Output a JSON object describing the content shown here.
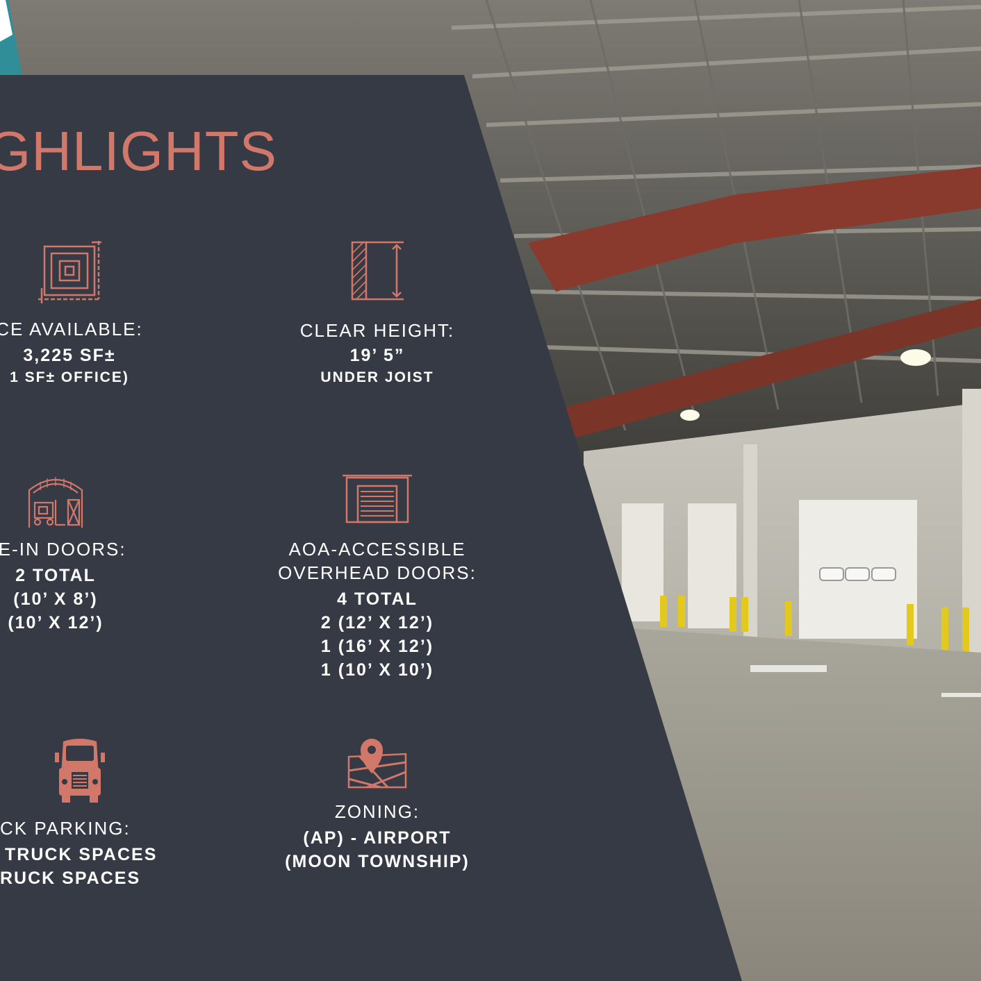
{
  "heading": "GHLIGHTS",
  "colors": {
    "panel": "#363a45",
    "accent": "#d2786a",
    "teal": "#2f8e98",
    "text": "#ffffff"
  },
  "items": {
    "space": {
      "icon": "floor-plan-icon",
      "label": "CE AVAILABLE:",
      "value": "3,225 SF±",
      "sub": "1 SF± OFFICE)"
    },
    "height": {
      "icon": "clear-height-icon",
      "label": "CLEAR HEIGHT:",
      "value": "19’ 5”",
      "sub": "UNDER JOIST"
    },
    "drive": {
      "icon": "warehouse-forklift-icon",
      "label": "VE-IN DOORS:",
      "lines": [
        "2 TOTAL",
        "(10’ X 8’)",
        "(10’ X 12’)"
      ]
    },
    "aoa": {
      "icon": "overhead-door-icon",
      "label1": "AOA-ACCESSIBLE",
      "label2": "OVERHEAD DOORS:",
      "lines": [
        "4 TOTAL",
        "2 (12’ X 12’)",
        "1 (16’ X 12’)",
        "1 (10’ X 10’)"
      ]
    },
    "parking": {
      "icon": "truck-icon",
      "label": "CK PARKING:",
      "lines": [
        "TRUCK SPACES",
        "RUCK SPACES"
      ]
    },
    "zoning": {
      "icon": "map-pin-icon",
      "label": "ZONING:",
      "lines": [
        "(AP) - AIRPORT",
        "(MOON TOWNSHIP)"
      ]
    }
  }
}
